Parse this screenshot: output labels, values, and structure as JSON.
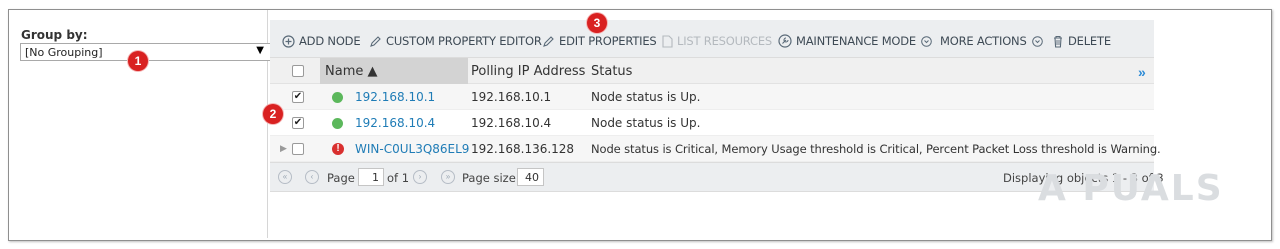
{
  "group_by": {
    "label": "Group by:",
    "selected": "[No Grouping]"
  },
  "toolbar": {
    "add_node": "ADD NODE",
    "custom_property_editor": "CUSTOM PROPERTY EDITOR",
    "edit_properties": "EDIT PROPERTIES",
    "list_resources": "LIST RESOURCES",
    "maintenance_mode": "MAINTENANCE MODE",
    "more_actions": "MORE ACTIONS",
    "delete": "DELETE"
  },
  "columns": {
    "name": "Name ▲",
    "polling_ip": "Polling IP Address",
    "status": "Status",
    "more": "»"
  },
  "rows": [
    {
      "name": "192.168.10.1",
      "ip": "192.168.10.1",
      "status": "Node status is Up.",
      "checked": "✔",
      "state": "up"
    },
    {
      "name": "192.168.10.4",
      "ip": "192.168.10.4",
      "status": "Node status is Up.",
      "checked": "✔",
      "state": "up"
    },
    {
      "name": "WIN-C0UL3Q86EL9",
      "ip": "192.168.136.128",
      "status": "Node status is Critical, Memory Usage threshold is Critical, Percent Packet Loss threshold is Warning.",
      "checked": "",
      "state": "critical"
    }
  ],
  "pager": {
    "page_label": "Page",
    "page_value": "1",
    "of_label": "of 1",
    "page_size_label": "Page size",
    "page_size_value": "40",
    "displaying": "Displaying objects 1 - 3 of 3"
  },
  "badges": [
    "1",
    "2",
    "3"
  ],
  "watermark": "A PUALS",
  "colors": {
    "up": "#5cb85c",
    "critical": "#d9302f",
    "link": "#1f7cb6",
    "badge": "#d92121"
  }
}
